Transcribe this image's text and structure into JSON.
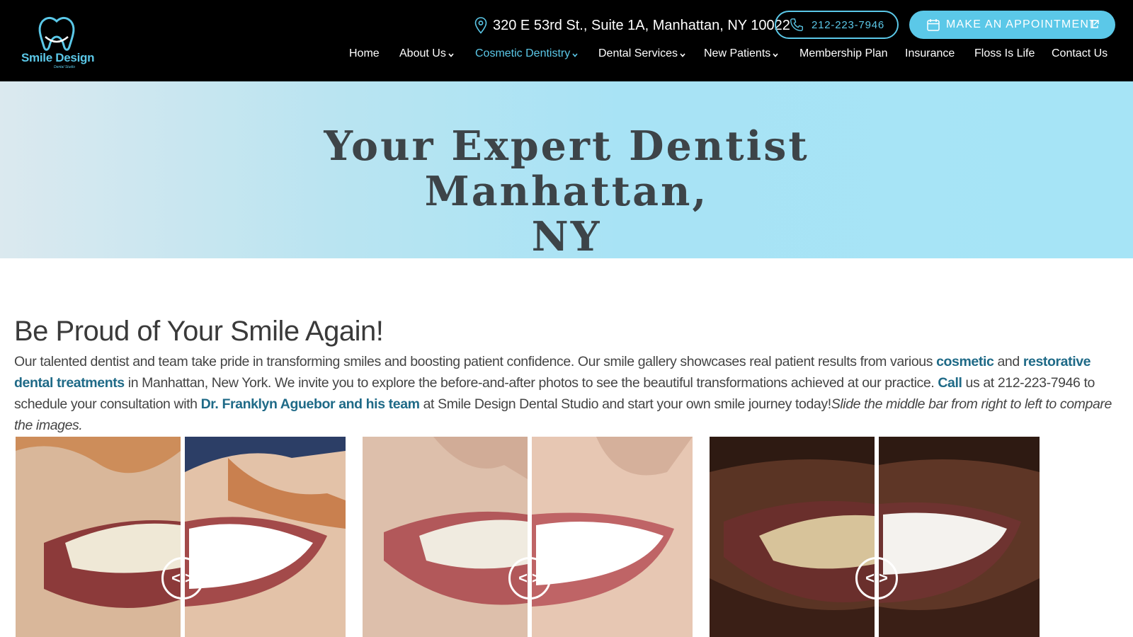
{
  "logo": {
    "name": "Smile Design",
    "sub": "Dental Studio"
  },
  "header": {
    "address": "320 E 53rd St., Suite 1A, Manhattan, NY 10022",
    "phone": "212-223-7946",
    "appointment": "Make an Appointment",
    "accent": "#5bc8e8"
  },
  "nav": [
    {
      "label": "Home"
    },
    {
      "label": "About Us"
    },
    {
      "label": "Cosmetic Dentistry"
    },
    {
      "label": "Dental Services"
    },
    {
      "label": "New Patients"
    },
    {
      "label": "Membership Plan"
    },
    {
      "label": "Insurance"
    },
    {
      "label": "Floss Is Life"
    },
    {
      "label": "Contact Us"
    }
  ],
  "hero": {
    "title_line1": "Your Expert Dentist Manhattan,",
    "title_line2": "NY"
  },
  "content": {
    "heading": "Be Proud of Your Smile Again!",
    "p1": "Our talented dentist and team take pride in transforming smiles and boosting patient confidence. Our smile gallery showcases real patient results from various ",
    "link_cosmetic": "cosmetic",
    "p2": " and ",
    "link_restorative": "restorative dental treatments",
    "p3": " in Manhattan, New York. We invite you to explore the before-and-after photos to see the beautiful transformations achieved at our practice. ",
    "link_call": "Call",
    "p4": " us at 212-223-7946 to schedule your consultation with ",
    "link_doctor": "Dr. Franklyn Aguebor and his team",
    "p5": " at Smile Design Dental Studio and start your own smile journey today!",
    "instruction": "Slide the middle bar from right to left to compare the images."
  },
  "gallery": [
    {
      "handle": "< >"
    },
    {
      "handle": "< >"
    },
    {
      "handle": "< >"
    }
  ]
}
